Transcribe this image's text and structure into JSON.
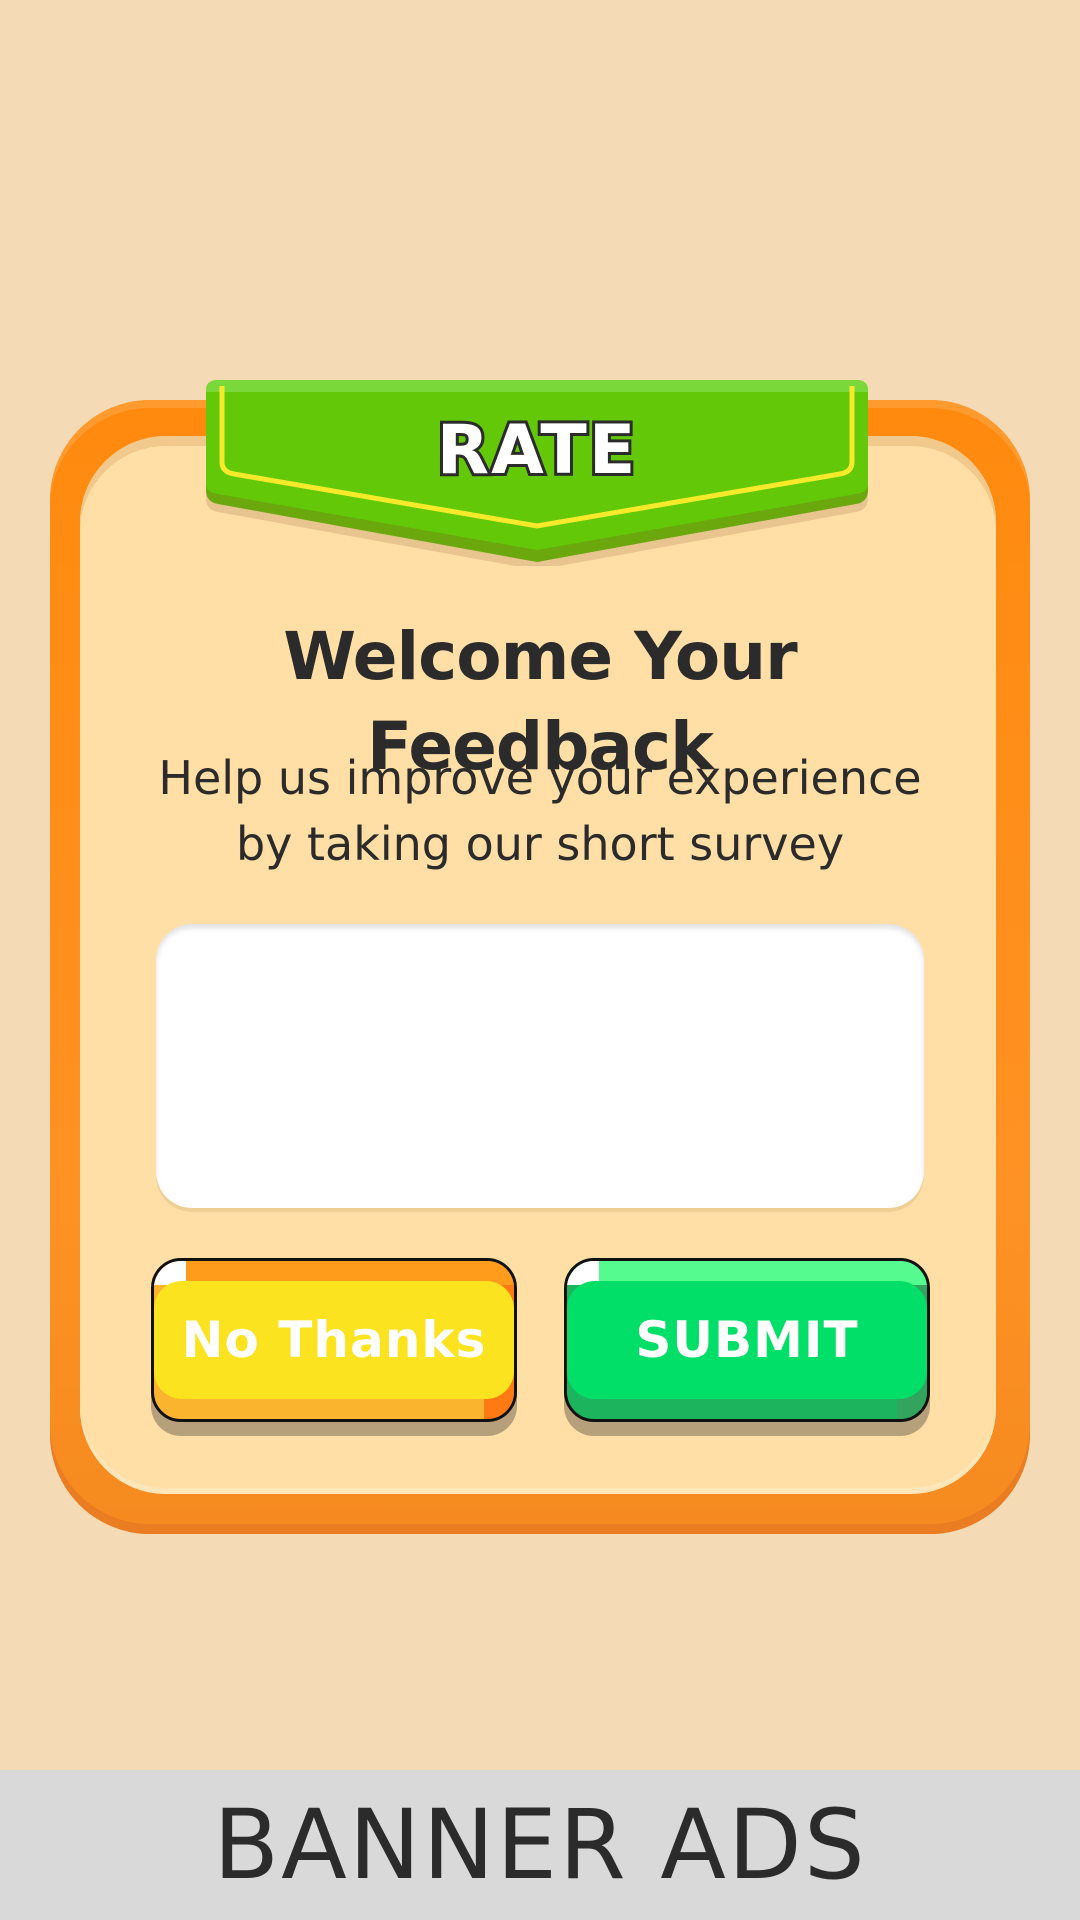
{
  "ribbon": {
    "title": "RATE"
  },
  "dialog": {
    "headline": "Welcome Your Feedback",
    "subtitle_line1": "Help us improve your experience",
    "subtitle_line2": "by taking our short survey",
    "feedback_value": ""
  },
  "buttons": {
    "no_thanks": "No Thanks",
    "submit": "SUBMIT"
  },
  "banner": {
    "label": "BANNER ADS"
  },
  "colors": {
    "background": "#f4dab5",
    "frame": "#ff8a0e",
    "panel": "#ffdfa6",
    "ribbon": "#5fc800",
    "no_thanks": "#fbe31f",
    "submit": "#02df68"
  }
}
